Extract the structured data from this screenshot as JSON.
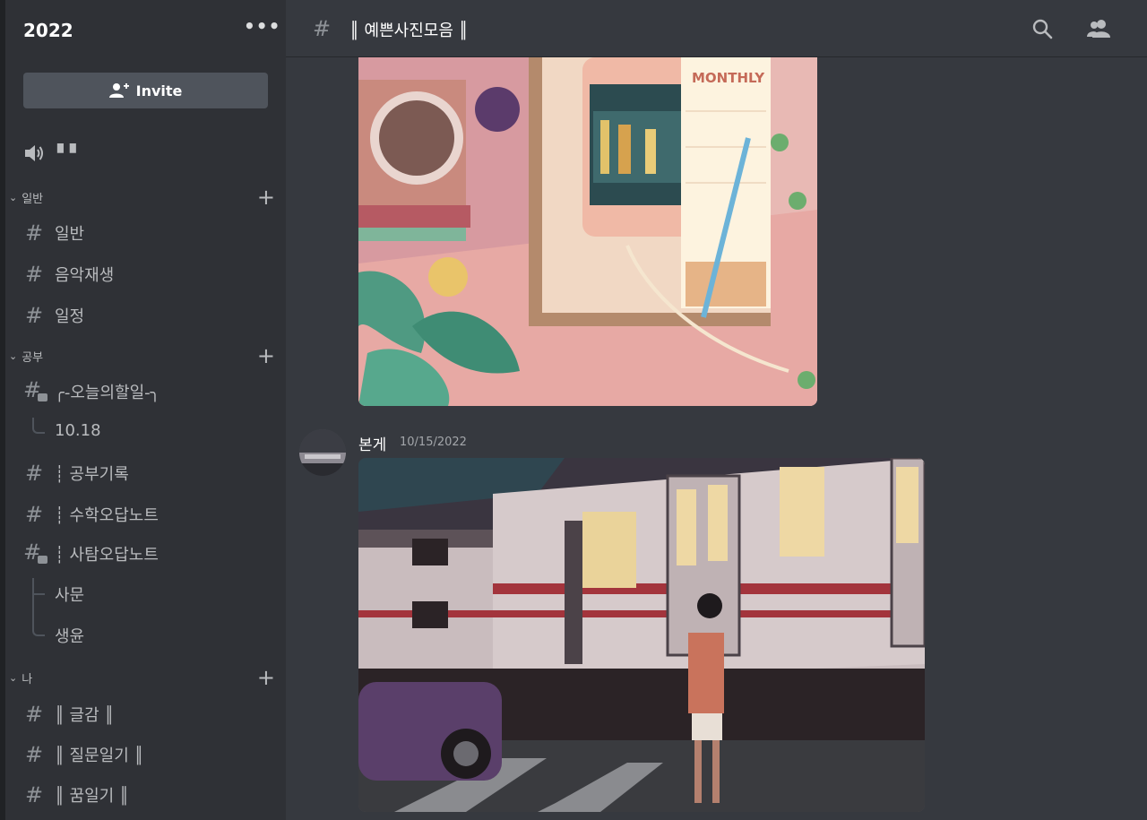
{
  "server": {
    "name": "2022",
    "more": "•••"
  },
  "invite": {
    "label": "Invite"
  },
  "voice": {
    "label": "▘▘"
  },
  "categories": [
    {
      "name": "일반",
      "channels": [
        "일반",
        "음악재생",
        "일정"
      ]
    },
    {
      "name": "공부",
      "channels": [
        "-오늘의할일-",
        "공부기록",
        "수학오답노트",
        "사탐오답노트"
      ]
    },
    {
      "name": "나",
      "channels": [
        "글감",
        "질문일기",
        "꿈일기"
      ]
    }
  ],
  "sidebar_text": {
    "ch_general": "일반",
    "ch_music": "음악재생",
    "ch_schedule": "일정",
    "ch_todo": "╭-오늘의할일-╮",
    "thread_1018": "10.18",
    "ch_study_log": "┊ 공부기록",
    "ch_math": "┊ 수학오답노트",
    "ch_social": "┊ 사탐오답노트",
    "thread_samun": "사문",
    "thread_saengyun": "생윤",
    "ch_writing": "║ 글감 ║",
    "ch_question": "║ 질문일기 ║",
    "ch_dream": "║ 꿈일기 ║"
  },
  "header": {
    "hash": "#",
    "title": "║ 예쁜사진모음 ║"
  },
  "message": {
    "author": "본게",
    "timestamp": "10/15/2022"
  },
  "icons": [
    "search-icon",
    "members-icon",
    "speaker-icon",
    "add-user-icon",
    "hash-icon",
    "thread-icon"
  ],
  "colors": {
    "sidebar": "#2f3136",
    "main": "#36393f",
    "button": "#4f545c"
  }
}
